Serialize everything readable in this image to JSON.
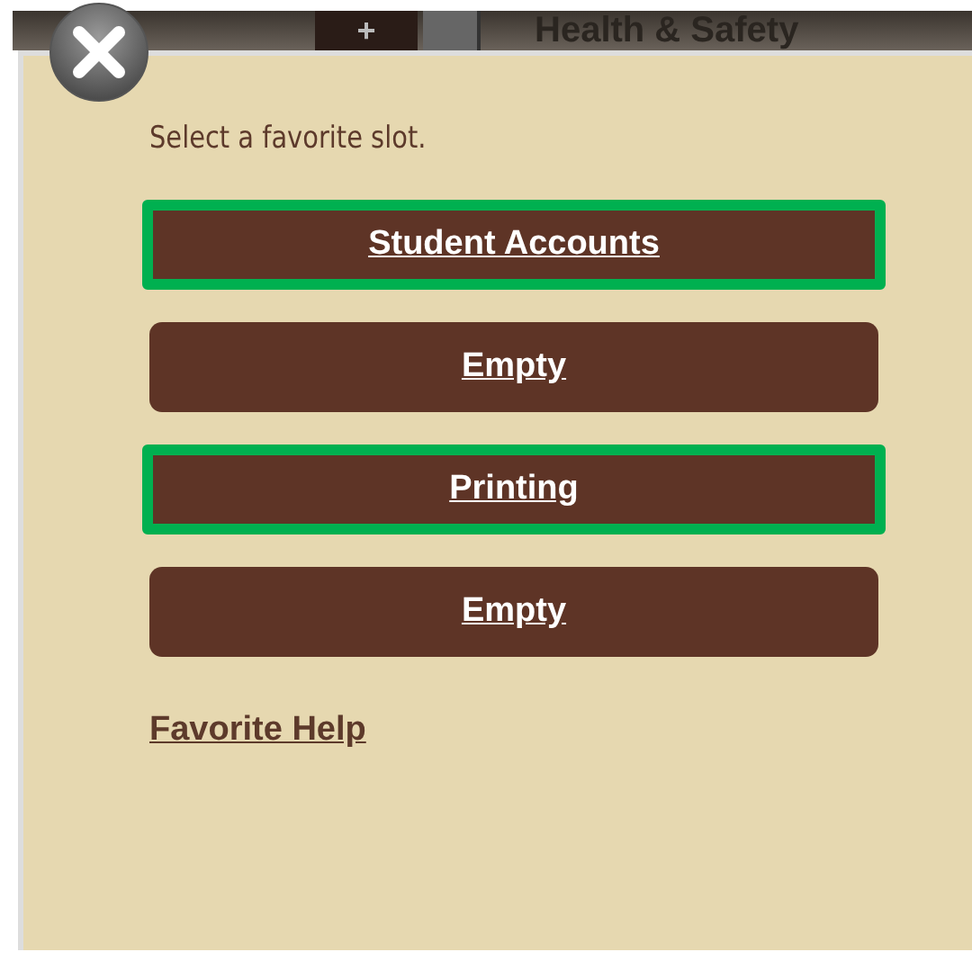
{
  "top_bar": {
    "add_tab": "+",
    "title": "Health & Safety"
  },
  "dialog": {
    "prompt": "Select a favorite slot.",
    "slots": [
      {
        "label": "Student Accounts",
        "highlighted": true
      },
      {
        "label": "Empty",
        "highlighted": false
      },
      {
        "label": "Printing",
        "highlighted": true
      },
      {
        "label": "Empty",
        "highlighted": false
      }
    ],
    "help_link": "Favorite Help"
  }
}
